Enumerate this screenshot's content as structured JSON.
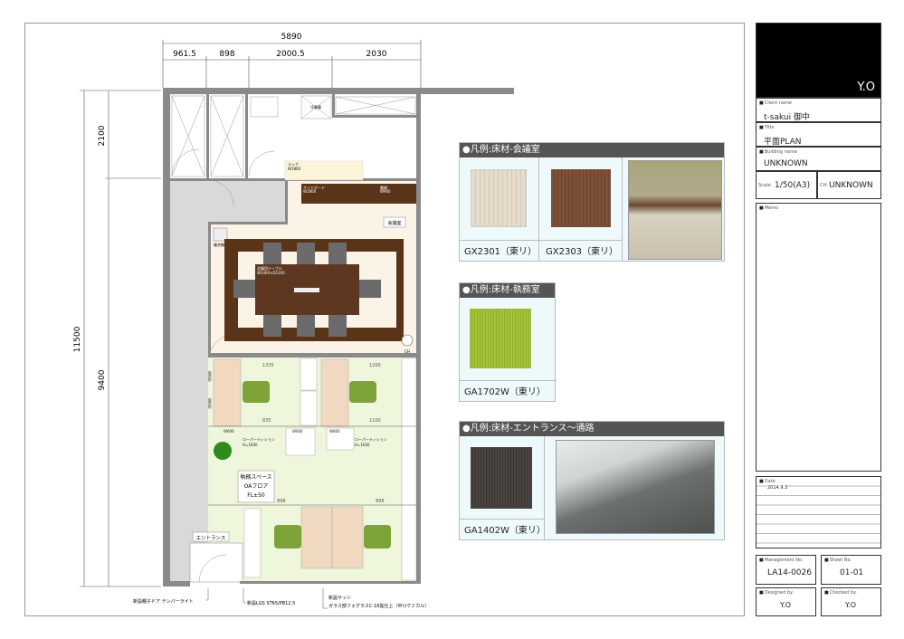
{
  "dimensions": {
    "total_width": "5890",
    "segments": [
      "961.5",
      "898",
      "2000.5",
      "2030"
    ],
    "total_height": "11500",
    "upper_height": "2100",
    "lower_height": "9400"
  },
  "plan": {
    "labels": {
      "fridge": "冷蔵庫",
      "rack": "ラック",
      "rack_w": "W1800",
      "sideboard": "サイドボード",
      "sideboard_w": "W1800",
      "shelf": "書棚",
      "shelf_w": "W900",
      "meeting_room": "会議室",
      "meeting_table": "会議用テーブル",
      "meeting_table_size": "W2400×D1200",
      "printer": "複合機",
      "ch": "CH",
      "dim_1335": "1335",
      "dim_1200": "1200",
      "dim_835": "835",
      "dim_1100": "1100",
      "dim_898a": "898",
      "dim_898b": "898",
      "w600_a": "W600",
      "w600_b": "W600",
      "w600_c": "W600",
      "w600_v1": "W600",
      "w600_v2": "W600",
      "low_partition_1": "ローパーティション",
      "low_partition_1_h": "H=1600",
      "low_partition_2": "ローパーティション",
      "low_partition_2_h": "H=1600",
      "office_space": "執務スペース",
      "oa_floor": "OAフロア",
      "fl": "FL±50",
      "entrance": "エントランス"
    },
    "notes": [
      "新設親子ドア テンパーライト",
      "新設LGS ST65/PB12.5",
      "新設サッシ",
      "ガラス部フォグラスC-16貼仕上（中川ケミカル）"
    ]
  },
  "legends": [
    {
      "title": "●凡例:床材-会議室",
      "items": [
        "GX2301（東リ）",
        "GX2303（東リ）"
      ]
    },
    {
      "title": "●凡例:床材-執務室",
      "items": [
        "GA1702W（東リ）"
      ]
    },
    {
      "title": "●凡例:床材-エントランス～通路",
      "items": [
        "GA1402W（東リ）"
      ]
    }
  ],
  "title_block": {
    "logo": "Y.O",
    "client_label": "Client name",
    "client": "t-sakui 御中",
    "title_label": "Title",
    "title": "平面PLAN",
    "building_label": "Building name",
    "building": "UNKNOWN",
    "scale_label": "Scale:",
    "scale": "1/50(A3)",
    "ch_label": "CH:",
    "ch": "UNKNOWN",
    "memo_label": "Memo",
    "date_label": "Date",
    "date": "2014.9.3",
    "management_label": "Management No.",
    "management": "LA14-0026",
    "sheet_label": "Sheet No.",
    "sheet": "01-01",
    "designed_label": "Designed by.",
    "designed": "Y.O",
    "checked_label": "Checked by.",
    "checked": "Y.O"
  },
  "colors": {
    "wall": "#8a8a8a",
    "corridor": "#d9d9d9",
    "meeting_floor": "#fbf3e6",
    "wood": "#5a3418",
    "office_floor": "#eef7dc",
    "desk": "#f1d9c1",
    "chair": "#7ea338",
    "legend_header": "#555555"
  }
}
